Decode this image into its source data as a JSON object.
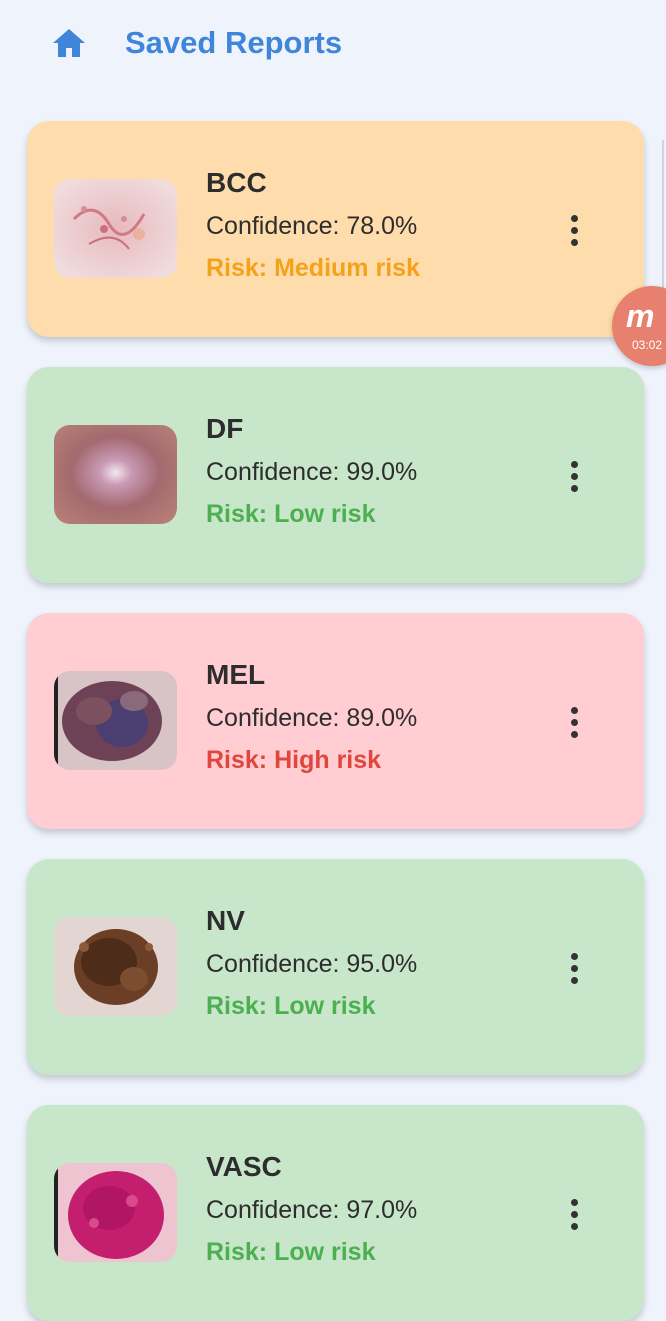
{
  "header": {
    "title": "Saved Reports",
    "home_icon": "home-icon"
  },
  "colors": {
    "background": "#eef3fc",
    "title": "#3f86db",
    "medium_card": "#fedcab",
    "low_card": "#c8e6c9",
    "high_card": "#ffcdd2",
    "medium_text": "#f4a21a",
    "low_text": "#4caf50",
    "high_text": "#e0463c"
  },
  "reports": [
    {
      "code": "BCC",
      "confidence": "Confidence: 78.0%",
      "risk": "Risk: Medium risk",
      "level": "medium"
    },
    {
      "code": "DF",
      "confidence": "Confidence: 99.0%",
      "risk": "Risk: Low risk",
      "level": "low"
    },
    {
      "code": "MEL",
      "confidence": "Confidence: 89.0%",
      "risk": "Risk: High risk",
      "level": "high"
    },
    {
      "code": "NV",
      "confidence": "Confidence: 95.0%",
      "risk": "Risk: Low risk",
      "level": "low"
    },
    {
      "code": "VASC",
      "confidence": "Confidence: 97.0%",
      "risk": "Risk: Low risk",
      "level": "low"
    }
  ],
  "overlay": {
    "glyph": "m",
    "time": "03:02"
  }
}
